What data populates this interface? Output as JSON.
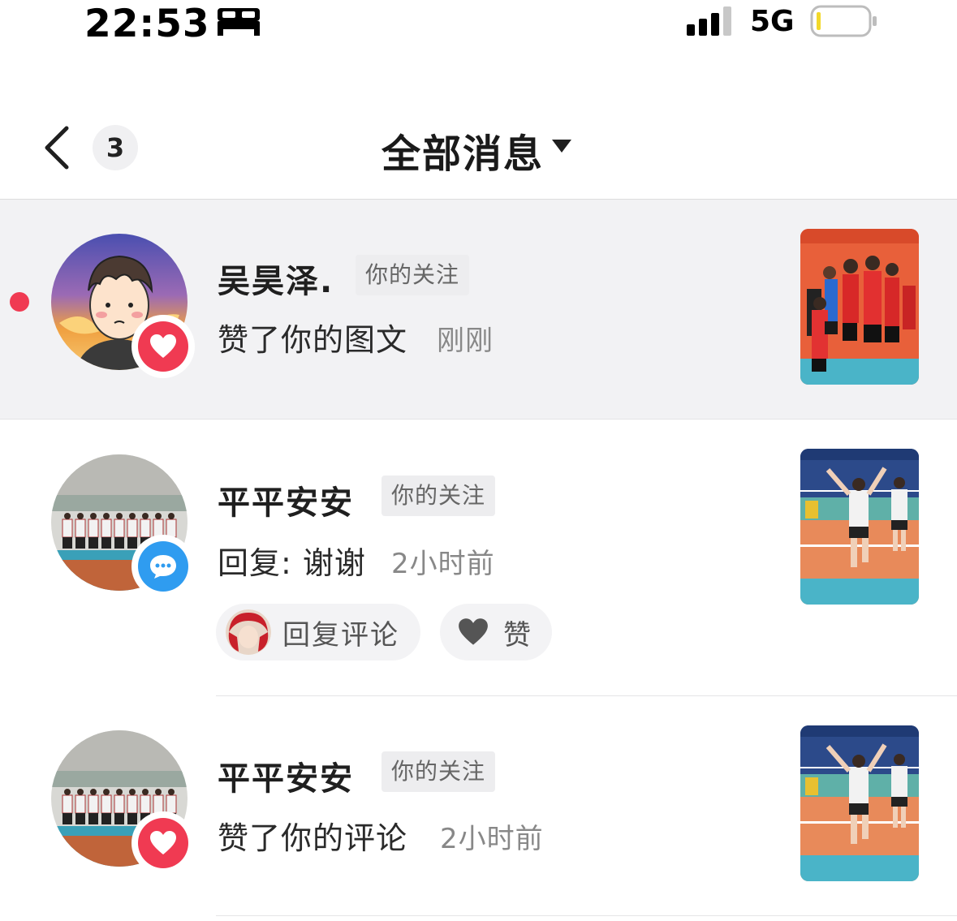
{
  "status_bar": {
    "time": "22:53",
    "network": "5G",
    "sleep_icon": "bed-icon",
    "signal_icon": "signal-bars-icon",
    "battery_icon": "battery-low-icon",
    "battery_level": 0.05
  },
  "header": {
    "back_icon": "chevron-left-icon",
    "unread_count": "3",
    "title": "全部消息",
    "dropdown_icon": "caret-down-icon"
  },
  "colors": {
    "unread_dot": "#f03a52",
    "like_badge": "#f03a52",
    "comment_badge": "#2f9cf0",
    "highlight_bg": "#f2f2f4"
  },
  "messages": [
    {
      "name": "吴昊泽.",
      "tag": "你的关注",
      "action": "赞了你的图文",
      "time": "刚刚",
      "badge": "heart-icon",
      "unread": true
    },
    {
      "name": "平平安安",
      "tag": "你的关注",
      "action": "回复: 谢谢",
      "time": "2小时前",
      "badge": "chat-bubble-icon",
      "unread": false,
      "reply_button": "回复评论",
      "like_button": "赞"
    },
    {
      "name": "平平安安",
      "tag": "你的关注",
      "action": "赞了你的评论",
      "time": "2小时前",
      "badge": "heart-icon",
      "unread": false
    }
  ]
}
